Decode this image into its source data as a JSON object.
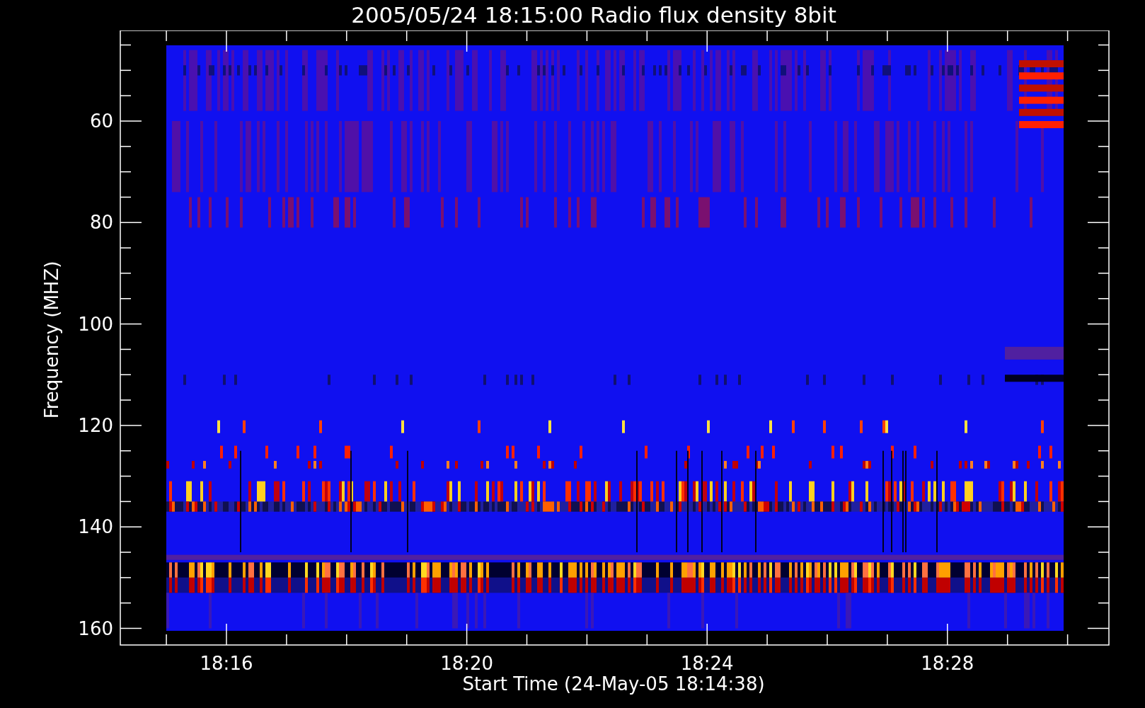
{
  "plot": {
    "title": "2005/05/24 18:15:00 Radio flux density 8bit",
    "xlabel": "Start Time (24-May-05 18:14:38)",
    "ylabel": "Frequency (MHZ)",
    "xticks": [
      "18:16",
      "18:20",
      "18:24",
      "18:28"
    ],
    "yticks": [
      "60",
      "80",
      "100",
      "120",
      "140",
      "160"
    ]
  }
}
